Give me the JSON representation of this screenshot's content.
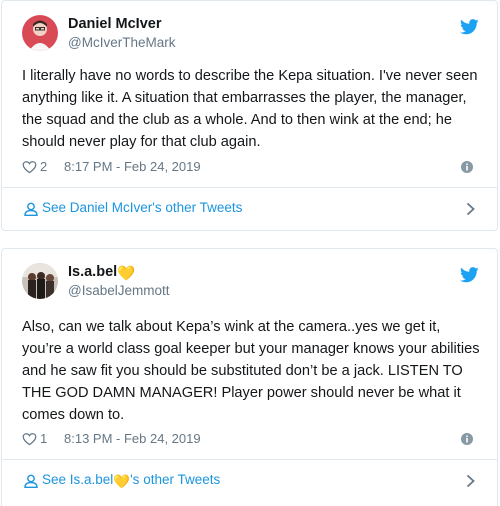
{
  "tweets": [
    {
      "name": "Daniel McIver",
      "handle": "@McIverTheMark",
      "text": "I literally have no words to describe the Kepa situation. I've never seen anything like it. A situation that embarrasses the player, the manager, the squad and the club as a whole. And to then wink at the end; he should never play for that club again.",
      "likes": "2",
      "time": "8:17 PM - Feb 24, 2019",
      "footer_link": "See Daniel McIver's other Tweets"
    },
    {
      "name": "Is.a.bel",
      "name_emoji": "💛",
      "handle": "@IsabelJemmott",
      "text": "Also, can we talk about Kepa’s wink at the camera..yes we get it, you’re a world class goal keeper but your manager knows your abilities and he saw fit you should be substituted don’t be a jack. LISTEN TO THE GOD DAMN MANAGER! Player power should never be what it comes down to.",
      "likes": "1",
      "time": "8:13 PM - Feb 24, 2019",
      "footer_link_prefix": "See Is.a.bel",
      "footer_link_suffix": "'s other Tweets"
    }
  ],
  "colors": {
    "link": "#1b95e0",
    "muted": "#657786",
    "text": "#14171a",
    "border": "#e1e8ed",
    "heart": "#f5c518"
  },
  "icons": [
    "twitter-bird-icon",
    "heart-outline-icon",
    "info-icon",
    "person-icon",
    "chevron-right-icon"
  ]
}
